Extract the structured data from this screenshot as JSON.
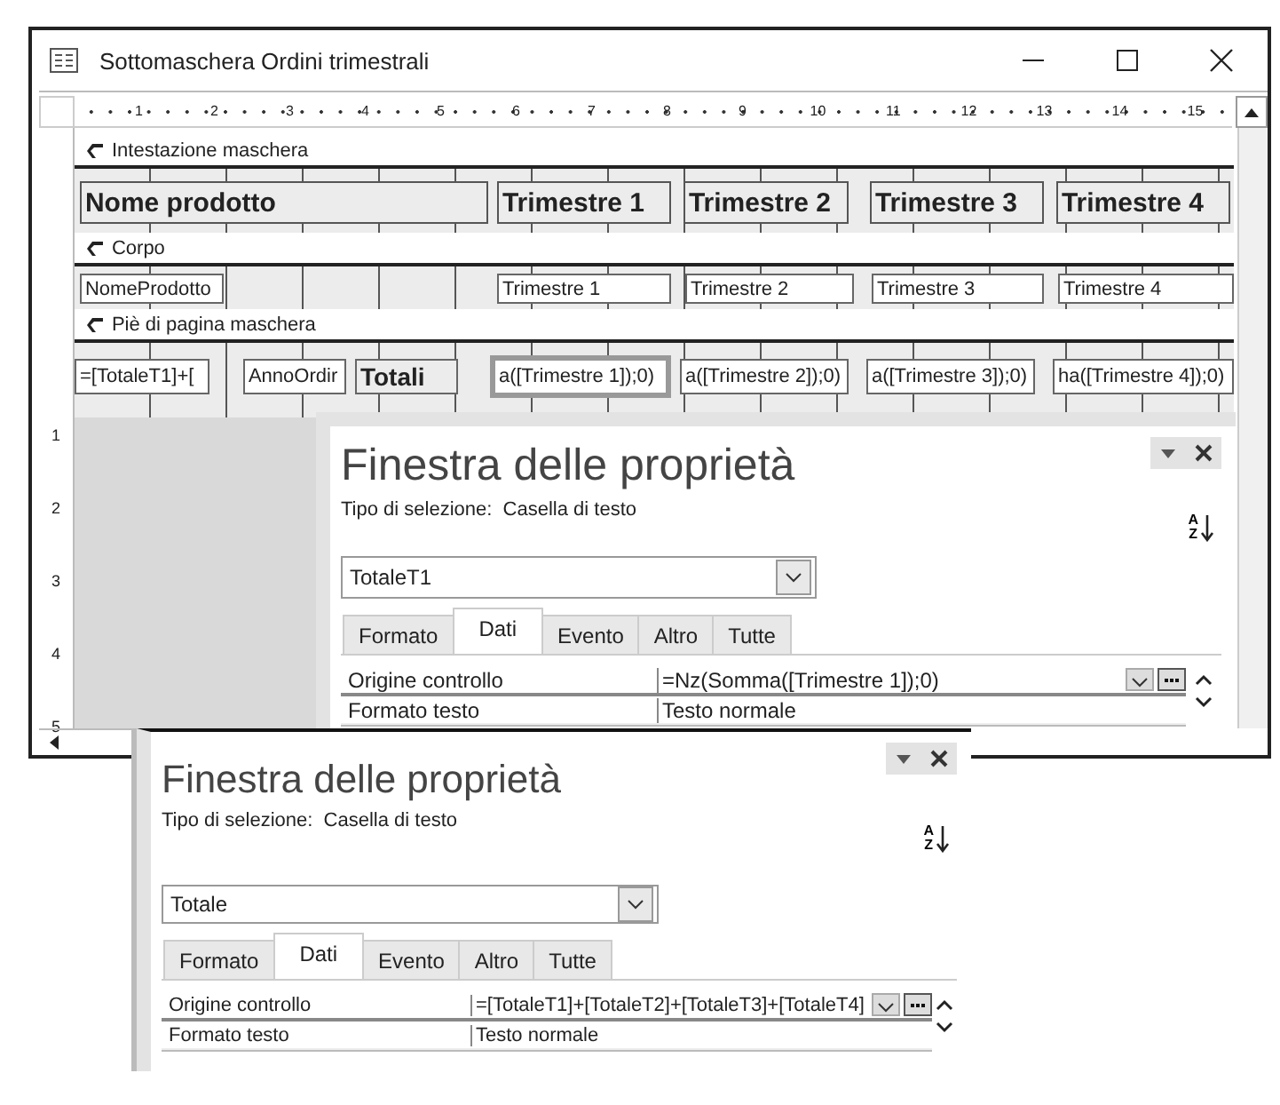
{
  "window": {
    "title": "Sottomaschera Ordini trimestrali"
  },
  "ruler": {
    "labels": [
      "1",
      "2",
      "3",
      "4",
      "5",
      "6",
      "7",
      "8",
      "9",
      "10",
      "11",
      "12",
      "13",
      "14",
      "15"
    ]
  },
  "vertical_ruler": {
    "labels": [
      "1",
      "2",
      "3",
      "4",
      "5"
    ]
  },
  "sections": [
    {
      "label": "Intestazione maschera",
      "controls": [
        {
          "kind": "label",
          "text": "Nome prodotto",
          "selected": false
        },
        {
          "kind": "label",
          "text": "Trimestre 1",
          "selected": false
        },
        {
          "kind": "label",
          "text": "Trimestre 2",
          "selected": false
        },
        {
          "kind": "label",
          "text": "Trimestre 3",
          "selected": false
        },
        {
          "kind": "label",
          "text": "Trimestre 4",
          "selected": false
        }
      ]
    },
    {
      "label": "Corpo",
      "controls": [
        {
          "kind": "textbox",
          "text": "NomeProdotto",
          "selected": false
        },
        {
          "kind": "textbox",
          "text": "Trimestre 1",
          "selected": false
        },
        {
          "kind": "textbox",
          "text": "Trimestre 2",
          "selected": false
        },
        {
          "kind": "textbox",
          "text": "Trimestre 3",
          "selected": false
        },
        {
          "kind": "textbox",
          "text": "Trimestre 4",
          "selected": false
        }
      ]
    },
    {
      "label": "Piè di pagina maschera",
      "controls": [
        {
          "kind": "textbox",
          "text": "=[TotaleT1]+[",
          "selected": false
        },
        {
          "kind": "textbox",
          "text": "AnnoOrdir",
          "selected": false
        },
        {
          "kind": "label",
          "text": "Totali",
          "selected": false
        },
        {
          "kind": "textbox",
          "text": "a([Trimestre 1]);0)",
          "selected": true
        },
        {
          "kind": "textbox",
          "text": "a([Trimestre 2]);0)",
          "selected": false
        },
        {
          "kind": "textbox",
          "text": "a([Trimestre 3]);0)",
          "selected": false
        },
        {
          "kind": "textbox",
          "text": "ha([Trimestre 4]);0)",
          "selected": false
        }
      ]
    }
  ],
  "property_sheets": [
    {
      "title": "Finestra delle proprietà",
      "selection_type": "Tipo di selezione:  Casella di testo",
      "sort_letters": [
        "A",
        "Z"
      ],
      "object": "TotaleT1",
      "tabs": [
        {
          "label": "Formato",
          "selected": false
        },
        {
          "label": "Dati",
          "selected": true
        },
        {
          "label": "Evento",
          "selected": false
        },
        {
          "label": "Altro",
          "selected": false
        },
        {
          "label": "Tutte",
          "selected": false
        }
      ],
      "properties": [
        {
          "name": "Origine controllo",
          "value": "=Nz(Somma([Trimestre 1]);0)",
          "selected": true
        },
        {
          "name": "Formato testo",
          "value": "Testo normale",
          "selected": false
        }
      ]
    },
    {
      "title": "Finestra delle proprietà",
      "selection_type": "Tipo di selezione:  Casella di testo",
      "sort_letters": [
        "A",
        "Z"
      ],
      "object": "Totale",
      "tabs": [
        {
          "label": "Formato",
          "selected": false
        },
        {
          "label": "Dati",
          "selected": true
        },
        {
          "label": "Evento",
          "selected": false
        },
        {
          "label": "Altro",
          "selected": false
        },
        {
          "label": "Tutte",
          "selected": false
        }
      ],
      "properties": [
        {
          "name": "Origine controllo",
          "value": "=[TotaleT1]+[TotaleT2]+[TotaleT3]+[TotaleT4]",
          "selected": true
        },
        {
          "name": "Formato testo",
          "value": "Testo normale",
          "selected": false
        }
      ]
    }
  ]
}
